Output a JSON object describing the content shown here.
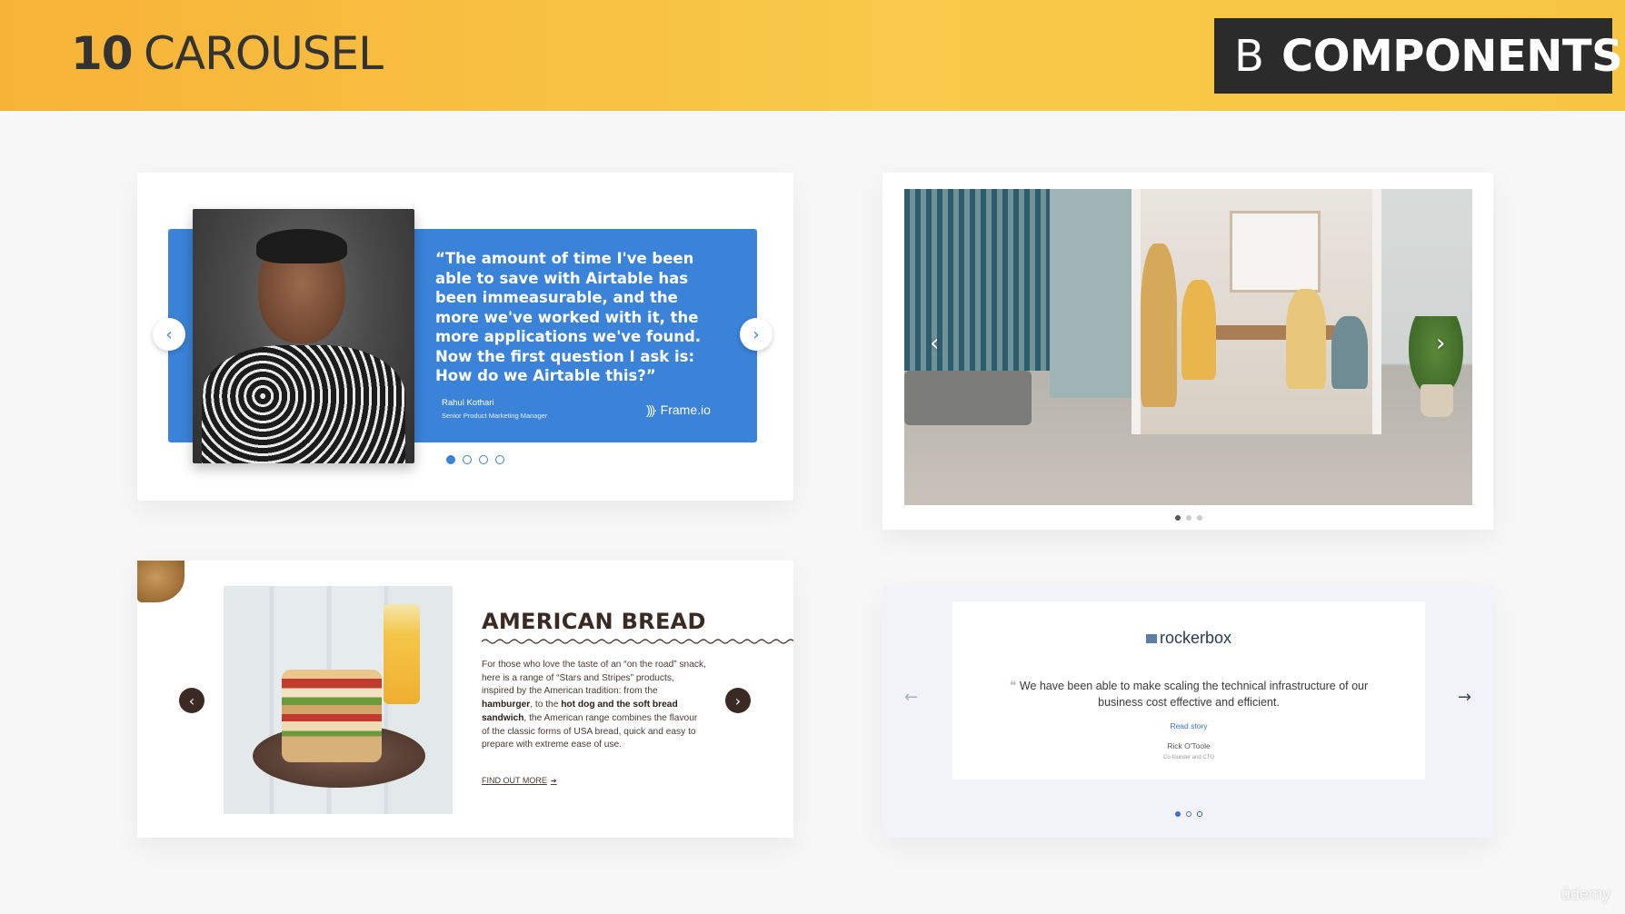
{
  "banner": {
    "number": "10",
    "title": "CAROUSEL",
    "box_letter": "B",
    "box_word": "COMPONENTS",
    "gradient_color": "#f7b338",
    "box_color": "#2b2b2b"
  },
  "airtable": {
    "quote": "“The amount of time I've been able to save with Airtable has been immeasurable, and the more we've worked with it, the more applications we've found. Now the first question I ask is: How do we Airtable this?”",
    "author": "Rahul Kothari",
    "role": "Senior Product Marketing Manager",
    "logo": "Frame.io",
    "logo_icon": "frameio-icon",
    "accent_color": "#3a83d9",
    "dots": 4,
    "active_dot": 0
  },
  "photo_carousel": {
    "dots": 3,
    "active_dot": 0
  },
  "bread": {
    "title": "AMERICAN BREAD",
    "body_1": "For those who love the taste of an “on the road” snack, here is a range of “Stars and Stripes” products, inspired by the American tradition: from the ",
    "bold_1": "hamburger",
    "body_2": ", to the ",
    "bold_2": "hot dog and the soft bread sandwich",
    "body_3": ", the American range combines the flavour of the classic forms of USA bread, quick and easy to prepare with extreme ease of use.",
    "link": "FIND OUT MORE",
    "link_arrow": "➔",
    "accent_color": "#3b2a24"
  },
  "rockerbox": {
    "logo": "rockerbox",
    "quote_mark": "❝",
    "quote": "We have been able to make scaling the technical infrastructure of our business cost effective and efficient.",
    "read_story": "Read story",
    "name": "Rick O'Toole",
    "role": "Co-founder and CTO",
    "accent_color": "#3a6fd8",
    "dots": 3,
    "active_dot": 0
  },
  "watermark": "ûdemy"
}
